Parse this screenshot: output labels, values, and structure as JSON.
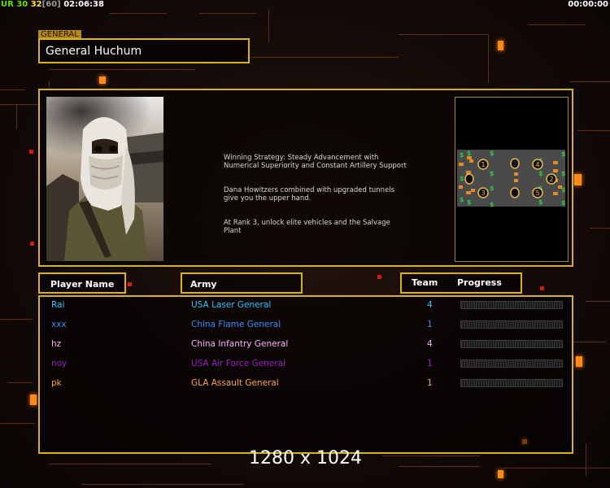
{
  "hud": {
    "left_label": "UR",
    "value_a": "30",
    "value_b": "32",
    "value_c": "[60]",
    "clock": "02:06:38",
    "timer": "00:00:00"
  },
  "general": {
    "tag": "GENERAL",
    "name": "General Huchum",
    "description": [
      "Winning Strategy: Steady Advancement with\n Numerical Superiority and Constant Artillery Support",
      "Dana Howitzers combined with upgraded tunnels\n give you the upper hand.",
      "At Rank 3, unlock elite vehicles and the Salvage\n Plant"
    ]
  },
  "map": {
    "start_positions": [
      "1",
      "2",
      "3",
      "4",
      "5"
    ]
  },
  "table": {
    "col_player": "Player Name",
    "col_army": "Army",
    "col_team": "Team",
    "col_progress": "Progress",
    "rows": [
      {
        "player": "Rai",
        "army": "USA Laser General",
        "team": "4",
        "color": "#2fc0ff",
        "progress": 0
      },
      {
        "player": "xxx",
        "army": "China Flame General",
        "team": "1",
        "color": "#3d8dff",
        "progress": 0
      },
      {
        "player": "hz",
        "army": "China Infantry General",
        "team": "4",
        "color": "#ffb0ff",
        "progress": 0
      },
      {
        "player": "noy",
        "army": "USA Air Force General",
        "team": "1",
        "color": "#9a1fc8",
        "progress": 0
      },
      {
        "player": "pk",
        "army": "GLA Assault General",
        "team": "1",
        "color": "#ffa640",
        "progress": 0
      }
    ]
  },
  "resolution": "1280 x 1024",
  "colors": {
    "hud_green": "#62e000",
    "hud_yellow": "#ffe040",
    "frame": "#d8b218",
    "accent": "#ff8a1a"
  }
}
